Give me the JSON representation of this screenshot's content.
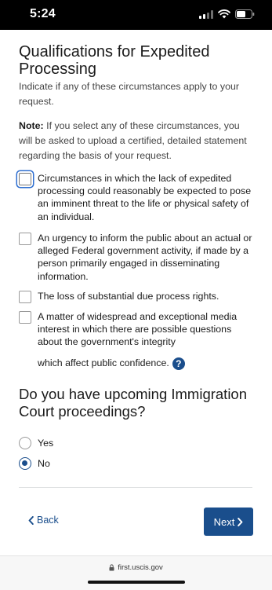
{
  "status_bar": {
    "time": "5:24",
    "signal_bars_active": 2,
    "signal_bars_total": 4,
    "battery_level": 0.55
  },
  "page": {
    "title": "Qualifications for Expedited Processing",
    "subtitle": "Indicate if any of these circumstances apply to your request.",
    "note_label": "Note:",
    "note_text": "If you select any of these circumstances, you will be asked to upload a certified, detailed statement regarding the basis of your request."
  },
  "circumstances": [
    {
      "label": "Circumstances in which the lack of expedited processing could reasonably be expected to pose an imminent threat to the life or physical safety of an individual.",
      "checked": false,
      "focused": true
    },
    {
      "label": "An urgency to inform the public about an actual or alleged Federal government activity, if made by a person primarily engaged in disseminating information.",
      "checked": false,
      "focused": false
    },
    {
      "label": "The loss of substantial due process rights.",
      "checked": false,
      "focused": false
    },
    {
      "label": "A matter of widespread and exceptional media interest in which there are possible questions about the government's integrity",
      "label_continued": "which affect public confidence.",
      "checked": false,
      "focused": false
    }
  ],
  "help_icon_glyph": "?",
  "court_question": {
    "heading": "Do you have upcoming Immigration Court proceedings?",
    "options": [
      {
        "label": "Yes",
        "selected": false
      },
      {
        "label": "No",
        "selected": true
      }
    ]
  },
  "navigation": {
    "back_label": "Back",
    "next_label": "Next"
  },
  "browser": {
    "url": "first.uscis.gov"
  },
  "colors": {
    "primary": "#1a4e8c",
    "focus_ring": "#2f6fd0",
    "text": "#1b1b1b",
    "muted_text": "#454545"
  },
  "icons": [
    "signal-icon",
    "wifi-icon",
    "battery-icon",
    "help-icon",
    "chevron-left-icon",
    "chevron-right-icon",
    "lock-icon"
  ]
}
